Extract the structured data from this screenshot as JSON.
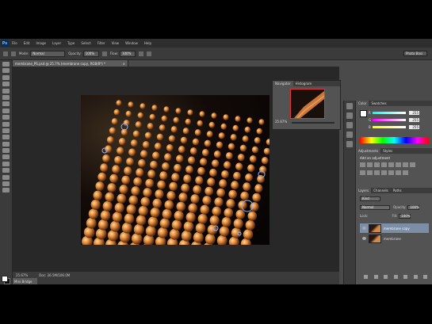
{
  "app": {
    "logo": "Ps"
  },
  "menu": [
    "File",
    "Edit",
    "Image",
    "Layer",
    "Type",
    "Select",
    "Filter",
    "View",
    "Window",
    "Help"
  ],
  "options": {
    "mode_label": "Mode:",
    "mode_value": "Normal",
    "opacity_label": "Opacity:",
    "opacity_value": "100%",
    "flow_label": "Flow:",
    "flow_value": "100%",
    "workspace": "Photo Basi"
  },
  "document": {
    "tab_title": "membrane_PS.psd @ 25.7% (membrane copy, RGB/8*) *",
    "close": "×"
  },
  "status": {
    "zoom": "25.67%",
    "doc": "Doc: 26.5M/106.0M"
  },
  "minibridge": {
    "label": "Mini Bridge"
  },
  "navigator": {
    "tabs": [
      "Navigator",
      "Histogram"
    ],
    "zoom": "25.67%"
  },
  "color_panel": {
    "tabs": [
      "Color",
      "Swatches"
    ],
    "rows": [
      {
        "label": "R",
        "value": "255"
      },
      {
        "label": "G",
        "value": "255"
      },
      {
        "label": "B",
        "value": "255"
      }
    ]
  },
  "adjustments": {
    "tabs": [
      "Adjustments",
      "Styles"
    ],
    "title": "Add an adjustment"
  },
  "layers": {
    "tabs": [
      "Layers",
      "Channels",
      "Paths"
    ],
    "kind": "Kind",
    "blend": "Normal",
    "opacity_label": "Opacity:",
    "opacity_value": "100%",
    "lock_label": "Lock:",
    "fill_label": "Fill:",
    "fill_value": "100%",
    "items": [
      {
        "name": "membrane copy"
      },
      {
        "name": "membrane"
      }
    ]
  },
  "colors": {
    "accent_selected": "#7b8ea5",
    "nav_box": "#e03535"
  }
}
